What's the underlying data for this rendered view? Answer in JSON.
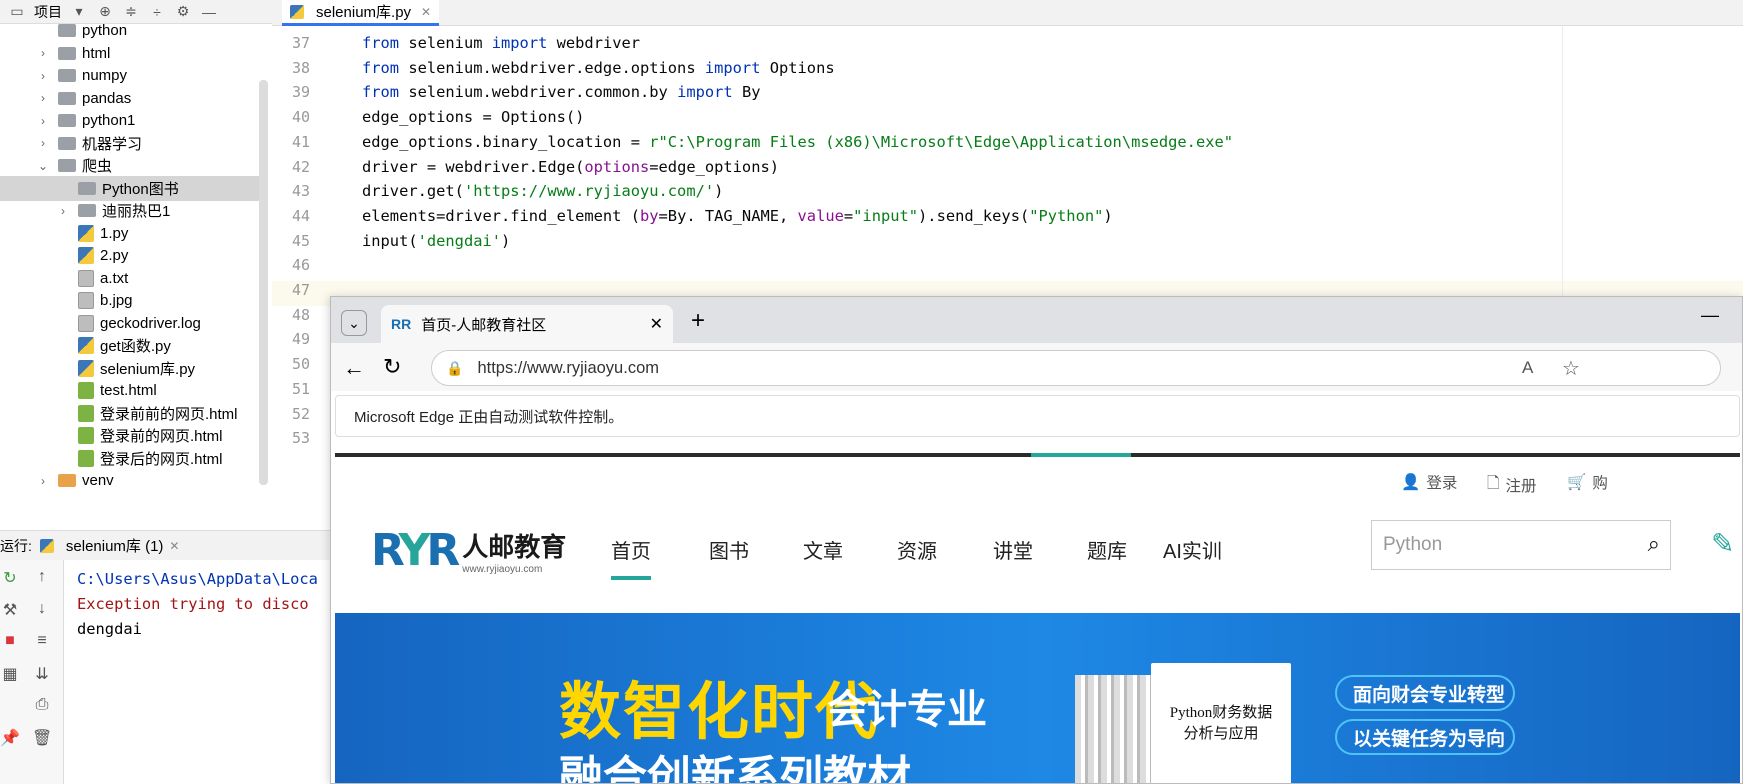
{
  "ide": {
    "project_label": "项目",
    "editor_tab": "selenium库.py",
    "tree": [
      {
        "label": "python",
        "indent": 1,
        "kind": "folder",
        "chevron": "",
        "partial": true
      },
      {
        "label": "html",
        "indent": 1,
        "kind": "folder",
        "chevron": "›"
      },
      {
        "label": "numpy",
        "indent": 1,
        "kind": "folder",
        "chevron": "›"
      },
      {
        "label": "pandas",
        "indent": 1,
        "kind": "folder",
        "chevron": "›"
      },
      {
        "label": "python1",
        "indent": 1,
        "kind": "folder",
        "chevron": "›"
      },
      {
        "label": "机器学习",
        "indent": 1,
        "kind": "folder",
        "chevron": "›"
      },
      {
        "label": "爬虫",
        "indent": 1,
        "kind": "folder",
        "chevron": "⌄"
      },
      {
        "label": "Python图书",
        "indent": 2,
        "kind": "folder",
        "chevron": "",
        "selected": true
      },
      {
        "label": "迪丽热巴1",
        "indent": 2,
        "kind": "folder",
        "chevron": "›"
      },
      {
        "label": "1.py",
        "indent": 2,
        "kind": "py",
        "chevron": ""
      },
      {
        "label": "2.py",
        "indent": 2,
        "kind": "py",
        "chevron": ""
      },
      {
        "label": "a.txt",
        "indent": 2,
        "kind": "txt",
        "chevron": ""
      },
      {
        "label": "b.jpg",
        "indent": 2,
        "kind": "img",
        "chevron": ""
      },
      {
        "label": "geckodriver.log",
        "indent": 2,
        "kind": "txt",
        "chevron": ""
      },
      {
        "label": "get函数.py",
        "indent": 2,
        "kind": "py",
        "chevron": ""
      },
      {
        "label": "selenium库.py",
        "indent": 2,
        "kind": "py",
        "chevron": ""
      },
      {
        "label": "test.html",
        "indent": 2,
        "kind": "html",
        "chevron": ""
      },
      {
        "label": "登录前前的网页.html",
        "indent": 2,
        "kind": "html",
        "chevron": ""
      },
      {
        "label": "登录前的网页.html",
        "indent": 2,
        "kind": "html",
        "chevron": ""
      },
      {
        "label": "登录后的网页.html",
        "indent": 2,
        "kind": "html",
        "chevron": ""
      },
      {
        "label": "venv",
        "indent": 1,
        "kind": "folder-orange",
        "chevron": "›",
        "partial": true
      }
    ],
    "line_numbers": [
      "37",
      "38",
      "39",
      "40",
      "41",
      "42",
      "43",
      "44",
      "45",
      "46",
      "47",
      "48",
      "49",
      "50",
      "51",
      "52",
      "53"
    ],
    "code": [
      [
        {
          "t": "from",
          "c": "kw"
        },
        {
          "t": " selenium "
        },
        {
          "t": "import",
          "c": "kw"
        },
        {
          "t": " webdriver"
        }
      ],
      [
        {
          "t": "from",
          "c": "kw"
        },
        {
          "t": " selenium.webdriver.edge.options "
        },
        {
          "t": "import",
          "c": "kw"
        },
        {
          "t": " Options"
        }
      ],
      [
        {
          "t": "from",
          "c": "kw"
        },
        {
          "t": " selenium.webdriver.common.by "
        },
        {
          "t": "import",
          "c": "kw"
        },
        {
          "t": " By"
        }
      ],
      [
        {
          "t": "edge_options = Options()"
        }
      ],
      [
        {
          "t": "edge_options.binary_location = "
        },
        {
          "t": "r\"C:\\Program Files (x86)\\Microsoft\\Edge\\Application\\msedge.exe\"",
          "c": "str"
        }
      ],
      [
        {
          "t": "driver = webdriver.Edge("
        },
        {
          "t": "options",
          "c": "param"
        },
        {
          "t": "=edge_options)"
        }
      ],
      [
        {
          "t": "driver.get("
        },
        {
          "t": "'https://www.ryjiaoyu.com/'",
          "c": "str"
        },
        {
          "t": ")"
        }
      ],
      [
        {
          "t": "elements=driver.find_element ("
        },
        {
          "t": "by",
          "c": "param"
        },
        {
          "t": "=By. TAG_NAME, "
        },
        {
          "t": "value",
          "c": "param"
        },
        {
          "t": "="
        },
        {
          "t": "\"input\"",
          "c": "str"
        },
        {
          "t": ").send_keys("
        },
        {
          "t": "\"Python\"",
          "c": "str"
        },
        {
          "t": ")"
        }
      ],
      [
        {
          "t": "input("
        },
        {
          "t": "'dengdai'",
          "c": "str"
        },
        {
          "t": ")"
        }
      ]
    ],
    "run_label": "运行:",
    "run_tab": "selenium库 (1)",
    "console": [
      {
        "text": "C:\\Users\\Asus\\AppData\\Loca",
        "color": "#0033b3"
      },
      {
        "text": "Exception trying to disco",
        "color": "#a31515"
      },
      {
        "text": "dengdai",
        "color": "#000000"
      }
    ]
  },
  "browser": {
    "tab_title": "首页-人邮教育社区",
    "url": "https://www.ryjiaoyu.com",
    "infobar": "Microsoft Edge 正由自动测试软件控制。",
    "site": {
      "login": "登录",
      "register": "注册",
      "cart_partial": "购",
      "logo_name": "人邮教育",
      "logo_url": "www.ryjiaoyu.com",
      "nav": [
        "首页",
        "图书",
        "文章",
        "资源",
        "讲堂",
        "题库",
        "AI实训"
      ],
      "search_value": "Python",
      "banner": {
        "headline_yellow": "数智化时代",
        "headline_white": "会计专业",
        "headline_line2": "融合创新系列教材",
        "book_title_1": "Python财务数据",
        "book_title_2": "分析与应用",
        "pill_1": "面向财会专业转型",
        "pill_2": "以关键任务为导向"
      }
    }
  },
  "colors": {
    "accent": "#3574f0",
    "site_green": "#26a69a",
    "banner_blue": "#1e88e5",
    "keyword": "#0033b3",
    "string": "#067d17"
  }
}
